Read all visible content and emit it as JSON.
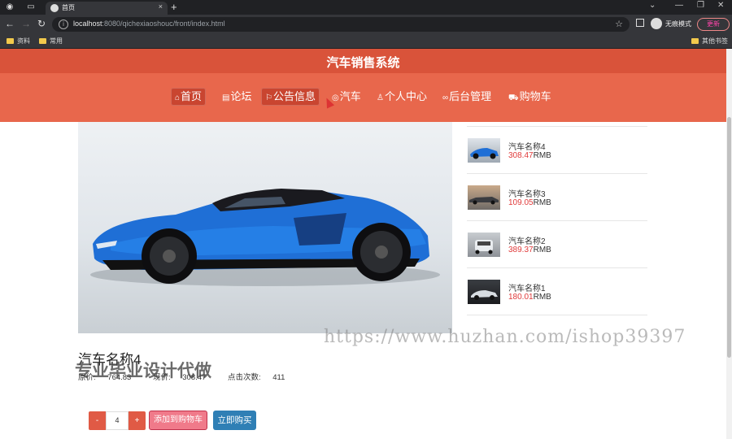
{
  "browser": {
    "tab_title": "首页",
    "url_host": "localhost",
    "url_rest": ":8080/qichexiaoshouc/front/index.html",
    "incognito_label": "无痕模式",
    "update_label": "更新",
    "bookmarks": [
      "资料",
      "常用"
    ],
    "other_bookmarks": "其他书签"
  },
  "site": {
    "title": "汽车销售系统",
    "nav": [
      {
        "label": "首页",
        "icon": "home-icon",
        "glyph": "⌂"
      },
      {
        "label": "论坛",
        "icon": "forum-icon",
        "glyph": "▤"
      },
      {
        "label": "公告信息",
        "icon": "flag-icon",
        "glyph": "⚐"
      },
      {
        "label": "汽车",
        "icon": "car-icon",
        "glyph": "◎"
      },
      {
        "label": "个人中心",
        "icon": "user-icon",
        "glyph": "♙"
      },
      {
        "label": "后台管理",
        "icon": "link-icon",
        "glyph": "∞"
      },
      {
        "label": "购物车",
        "icon": "cart-icon",
        "glyph": "⛟"
      }
    ]
  },
  "product": {
    "name": "汽车名称4",
    "original_price_label": "原价:",
    "original_price": "764.83",
    "current_price_label": "现价:",
    "current_price": "308.47",
    "clicks_label": "点击次数:",
    "clicks": "411",
    "quantity": "4",
    "minus": "-",
    "plus": "+",
    "add_to_cart": "添加到购物车",
    "buy_now": "立即购买"
  },
  "side_list": [
    {
      "name": "汽车名称4",
      "price": "308.47",
      "unit": "RMB"
    },
    {
      "name": "汽车名称3",
      "price": "109.05",
      "unit": "RMB"
    },
    {
      "name": "汽车名称2",
      "price": "389.37",
      "unit": "RMB"
    },
    {
      "name": "汽车名称1",
      "price": "180.01",
      "unit": "RMB"
    }
  ],
  "watermark": {
    "url": "https://www.huzhan.com/ishop39397",
    "text": "专业毕业设计代做"
  },
  "colors": {
    "header": "#e8674c",
    "header_title_band": "#d9533a",
    "price": "#e03a3a",
    "cart_button": "#f07a8a",
    "buy_button": "#2f7fb5"
  }
}
